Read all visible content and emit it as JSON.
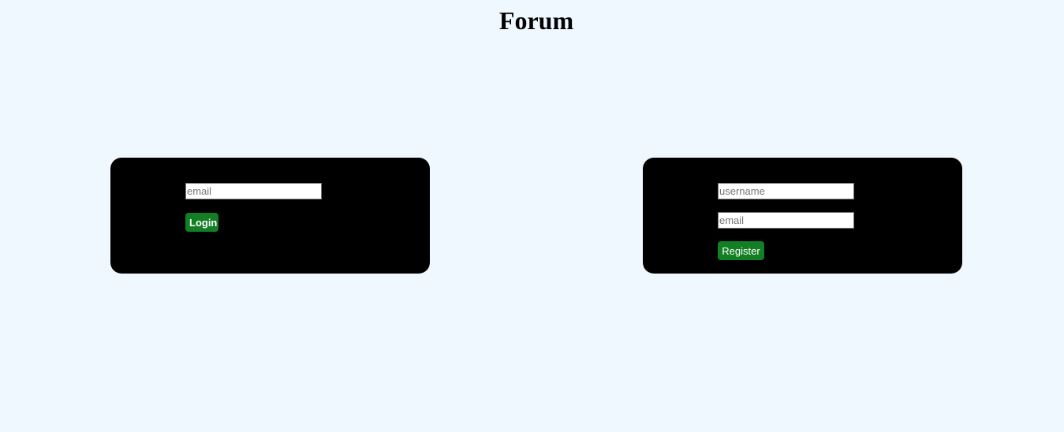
{
  "page": {
    "title": "Forum"
  },
  "login": {
    "email_placeholder": "email",
    "email_value": "",
    "button_label": "Login"
  },
  "register": {
    "username_placeholder": "username",
    "username_value": "",
    "email_placeholder": "email",
    "email_value": "",
    "button_label": "Register"
  },
  "colors": {
    "background": "#f0f8ff",
    "panel": "#000000",
    "button": "#137f25",
    "button_text": "#ffffff"
  }
}
